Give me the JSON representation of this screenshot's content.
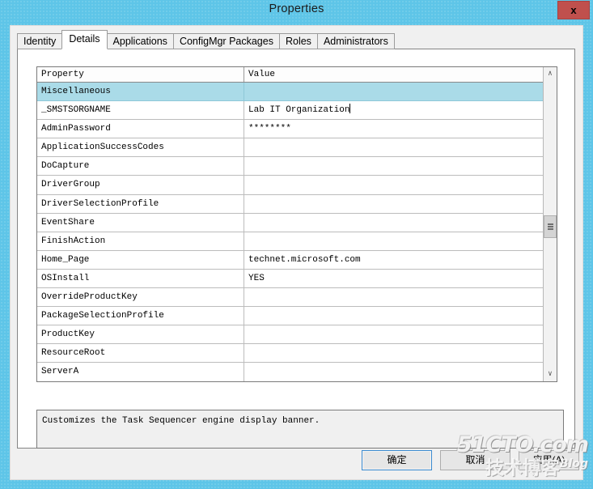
{
  "window": {
    "title": "Properties",
    "close_label": "x",
    "titlebar_color": "#5ec5e8",
    "close_color": "#c0504d"
  },
  "tabs": [
    {
      "label": "Identity",
      "active": false
    },
    {
      "label": "Details",
      "active": true
    },
    {
      "label": "Applications",
      "active": false
    },
    {
      "label": "ConfigMgr Packages",
      "active": false
    },
    {
      "label": "Roles",
      "active": false
    },
    {
      "label": "Administrators",
      "active": false
    }
  ],
  "grid": {
    "columns": [
      "Property",
      "Value"
    ],
    "selection_color": "#aadbe8",
    "rows": [
      {
        "property": "Miscellaneous",
        "value": "",
        "section": true
      },
      {
        "property": "_SMSTSORGNAME",
        "value": "Lab IT Organization",
        "section": false,
        "caret": true
      },
      {
        "property": "AdminPassword",
        "value": "********",
        "section": false
      },
      {
        "property": "ApplicationSuccessCodes",
        "value": "",
        "section": false
      },
      {
        "property": "DoCapture",
        "value": "",
        "section": false
      },
      {
        "property": "DriverGroup",
        "value": "",
        "section": false
      },
      {
        "property": "DriverSelectionProfile",
        "value": "",
        "section": false
      },
      {
        "property": "EventShare",
        "value": "",
        "section": false
      },
      {
        "property": "FinishAction",
        "value": "",
        "section": false
      },
      {
        "property": "Home_Page",
        "value": "technet.microsoft.com",
        "section": false
      },
      {
        "property": "OSInstall",
        "value": "YES",
        "section": false
      },
      {
        "property": "OverrideProductKey",
        "value": "",
        "section": false
      },
      {
        "property": "PackageSelectionProfile",
        "value": "",
        "section": false
      },
      {
        "property": "ProductKey",
        "value": "",
        "section": false
      },
      {
        "property": "ResourceRoot",
        "value": "",
        "section": false
      },
      {
        "property": "ServerA",
        "value": "",
        "section": false
      }
    ]
  },
  "scrollbar": {
    "up_glyph": "∧",
    "down_glyph": "∨"
  },
  "description": {
    "text": "Customizes the Task Sequencer engine display banner."
  },
  "buttons": {
    "ok": "确定",
    "cancel": "取消",
    "apply": "应用(A)"
  },
  "watermark": {
    "line1": "51CTO.com",
    "line2": "技术博客",
    "blog": "Blog"
  }
}
